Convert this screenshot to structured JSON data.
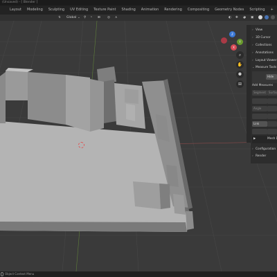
{
  "window": {
    "title": "(Unsaved) - [ Blender ]"
  },
  "workspace_tabs": [
    "Layout",
    "Modeling",
    "Sculpting",
    "UV Editing",
    "Texture Paint",
    "Shading",
    "Animation",
    "Rendering",
    "Compositing",
    "Geometry Nodes",
    "Scripting",
    "+"
  ],
  "header": {
    "orientation": "Global"
  },
  "gizmo": {
    "x_label": "X",
    "y_label": "Y",
    "z_label": "Z"
  },
  "sidebar": {
    "panels": [
      {
        "label": "View"
      },
      {
        "label": "3D Cursor"
      },
      {
        "label": "Collections"
      },
      {
        "label": "Annotations"
      },
      {
        "label": "Layout Viewer"
      },
      {
        "label": "Measure Tools"
      }
    ],
    "hide_button": "Hide",
    "add_measures_label": "Add Measures",
    "segment_button": "Segment",
    "surface_button": "Surface",
    "angle_button": "Angle",
    "link_button": "Link",
    "mesh_label": "Mesh D",
    "configuration_label": "Configuration",
    "render_label": "Render"
  },
  "status": {
    "text": "Object Context Menu"
  }
}
